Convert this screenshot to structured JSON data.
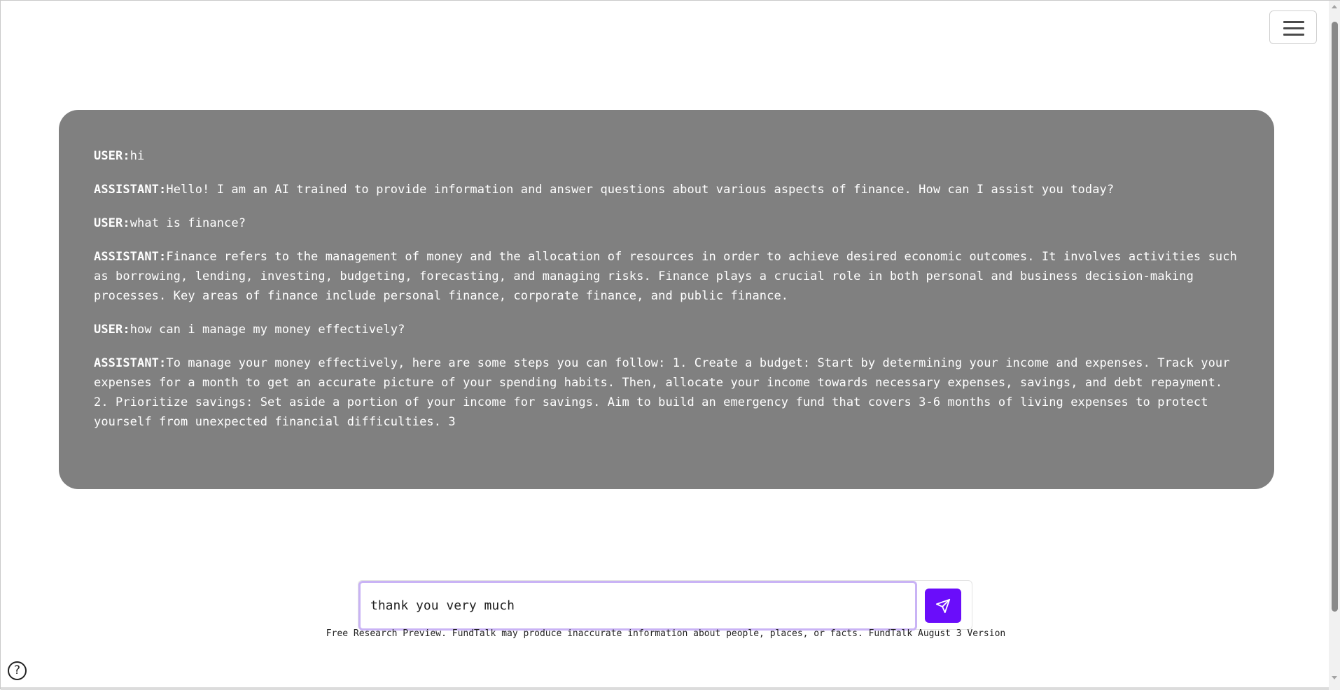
{
  "header": {
    "menu_icon": "hamburger-menu-icon"
  },
  "chat": {
    "messages": [
      {
        "role": "USER:",
        "text": "hi"
      },
      {
        "role": "ASSISTANT:",
        "text": "Hello! I am an AI trained to provide information and answer questions about various aspects of finance. How can I assist you today?"
      },
      {
        "role": "USER:",
        "text": "what is finance?"
      },
      {
        "role": "ASSISTANT:",
        "text": "Finance refers to the management of money and the allocation of resources in order to achieve desired economic outcomes. It involves activities such as borrowing, lending, investing, budgeting, forecasting, and managing risks. Finance plays a crucial role in both personal and business decision-making processes. Key areas of finance include personal finance, corporate finance, and public finance."
      },
      {
        "role": "USER:",
        "text": "how can i manage my money effectively?"
      },
      {
        "role": "ASSISTANT:",
        "text": "To manage your money effectively, here are some steps you can follow: 1. Create a budget: Start by determining your income and expenses. Track your expenses for a month to get an accurate picture of your spending habits. Then, allocate your income towards necessary expenses, savings, and debt repayment. 2. Prioritize savings: Set aside a portion of your income for savings. Aim to build an emergency fund that covers 3-6 months of living expenses to protect yourself from unexpected financial difficulties. 3"
      }
    ]
  },
  "composer": {
    "input_value": "thank you very much",
    "send_icon": "send-paper-plane-icon",
    "accent_color": "#6a0dfa"
  },
  "footer": {
    "disclaimer": "Free Research Preview. FundTalk may produce inaccurate information about people, places, or facts. FundTalk August 3 Version",
    "help_label": "?"
  }
}
